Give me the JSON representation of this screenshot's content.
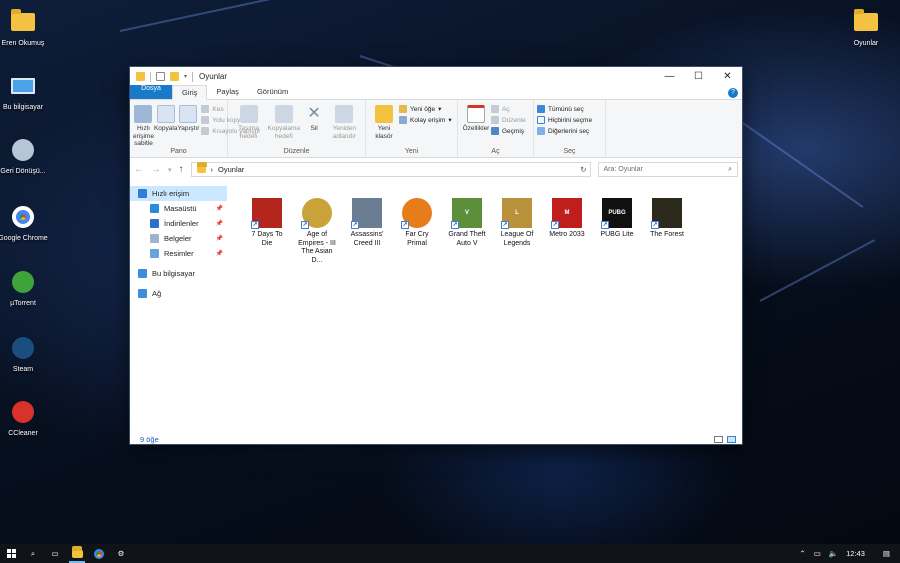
{
  "desktop": {
    "icons": [
      {
        "label": "Eren Okumuş",
        "icon": "user-folder-icon"
      },
      {
        "label": "Bu bilgisayar",
        "icon": "computer-icon"
      },
      {
        "label": "Geri Dönüşü...",
        "icon": "recycle-bin-icon"
      },
      {
        "label": "Google Chrome",
        "icon": "chrome-icon"
      },
      {
        "label": "µTorrent",
        "icon": "utorrent-icon"
      },
      {
        "label": "Steam",
        "icon": "steam-icon"
      },
      {
        "label": "CCleaner",
        "icon": "ccleaner-icon"
      }
    ],
    "right_icon": {
      "label": "Oyunlar",
      "icon": "folder-icon"
    }
  },
  "window": {
    "title": "Oyunlar",
    "buttons": {
      "minimize": "—",
      "maximize": "☐",
      "close": "✕"
    },
    "tabs": [
      "Dosya",
      "Giriş",
      "Paylaş",
      "Görünüm"
    ],
    "help": "?",
    "ribbon": {
      "pano": {
        "label": "Pano",
        "pin": "Hızlı erişime sabitle",
        "copy": "Kopyala",
        "paste": "Yapıştır",
        "cut": "Kes",
        "copy_path": "Yolu kopyala",
        "paste_shortcut": "Kısayolu yapıştır"
      },
      "duzenle": {
        "label": "Düzenle",
        "move_to": "Taşıma hedefi",
        "copy_to": "Kopyalama hedefi",
        "delete": "Sil",
        "rename": "Yeniden adlandır"
      },
      "yeni": {
        "label": "Yeni",
        "new_folder": "Yeni klasör",
        "new_item": "Yeni öğe",
        "easy_access": "Kolay erişim"
      },
      "ac": {
        "label": "Aç",
        "properties": "Özellikler",
        "open": "Aç",
        "edit": "Düzenle",
        "history": "Geçmiş"
      },
      "sec": {
        "label": "Seç",
        "select_all": "Tümünü seç",
        "select_none": "Hiçbirini seçme",
        "invert": "Diğerlerini seç"
      }
    },
    "address": {
      "path": "Oyunlar",
      "separator": "›",
      "search_placeholder": "Ara: Oyunlar"
    },
    "nav_pane": [
      {
        "label": "Hızlı erişim",
        "icon": "star-icon",
        "selected": true,
        "indent": false,
        "pinned": false,
        "color": "#2f7fd6"
      },
      {
        "label": "Masaüstü",
        "icon": "desktop-icon",
        "selected": false,
        "indent": true,
        "pinned": true,
        "color": "#2a8ae0"
      },
      {
        "label": "İndirilenler",
        "icon": "download-icon",
        "selected": false,
        "indent": true,
        "pinned": true,
        "color": "#2a6fc9"
      },
      {
        "label": "Belgeler",
        "icon": "documents-icon",
        "selected": false,
        "indent": true,
        "pinned": true,
        "color": "#9fb4cc"
      },
      {
        "label": "Resimler",
        "icon": "pictures-icon",
        "selected": false,
        "indent": true,
        "pinned": true,
        "color": "#6aa3dc"
      },
      {
        "label": "Bu bilgisayar",
        "icon": "computer-icon",
        "selected": false,
        "indent": false,
        "pinned": false,
        "color": "#3a8edb"
      },
      {
        "label": "Ağ",
        "icon": "network-icon",
        "selected": false,
        "indent": false,
        "pinned": false,
        "color": "#3a8edb"
      }
    ],
    "files": [
      {
        "name": "7 Days To Die",
        "icon": "7-days-to-die-icon",
        "bg": "#b3261e",
        "mark": ""
      },
      {
        "name": "Age of Empires - III The Asian D...",
        "icon": "age-of-empires-icon",
        "bg": "#c9a23a",
        "mark": ""
      },
      {
        "name": "Assassins' Creed III",
        "icon": "assassins-creed-icon",
        "bg": "#6b7d93",
        "mark": ""
      },
      {
        "name": "Far Cry Primal",
        "icon": "far-cry-primal-icon",
        "bg": "#e67d1a",
        "mark": ""
      },
      {
        "name": "Grand Theft Auto V",
        "icon": "gta-v-icon",
        "bg": "#5b8f3a",
        "mark": "V"
      },
      {
        "name": "League Of Legends",
        "icon": "league-of-legends-icon",
        "bg": "#b8913a",
        "mark": "L"
      },
      {
        "name": "Metro 2033",
        "icon": "metro-2033-icon",
        "bg": "#c01d1d",
        "mark": "M"
      },
      {
        "name": "PUBG Lite",
        "icon": "pubg-lite-icon",
        "bg": "#111111",
        "mark": "PUBG"
      },
      {
        "name": "The Forest",
        "icon": "the-forest-icon",
        "bg": "#2c2a1d",
        "mark": ""
      }
    ],
    "status": "9 öğe"
  },
  "taskbar": {
    "time": "12:43"
  }
}
